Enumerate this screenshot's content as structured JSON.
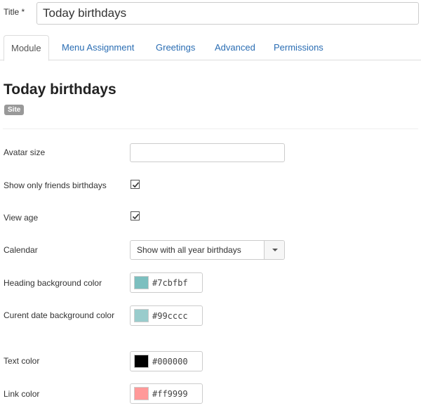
{
  "title_field": {
    "label": "Title *",
    "value": "Today birthdays"
  },
  "tabs": [
    {
      "label": "Module",
      "active": true
    },
    {
      "label": "Menu Assignment",
      "active": false
    },
    {
      "label": "Greetings",
      "active": false
    },
    {
      "label": "Advanced",
      "active": false
    },
    {
      "label": "Permissions",
      "active": false
    }
  ],
  "module": {
    "title": "Today birthdays",
    "badge": "Site"
  },
  "fields": {
    "avatar_size": {
      "label": "Avatar size",
      "value": ""
    },
    "friends_only": {
      "label": "Show only friends birthdays",
      "checked": true
    },
    "view_age": {
      "label": "View age",
      "checked": true
    },
    "calendar": {
      "label": "Calendar",
      "value": "Show with all year birthdays"
    },
    "heading_bg": {
      "label": "Heading background color",
      "value": "#7cbfbf",
      "color": "#7cbfbf"
    },
    "current_date_bg": {
      "label": "Curent date background color",
      "value": "#99cccc",
      "color": "#99cccc"
    },
    "text_color": {
      "label": "Text color",
      "value": "#000000",
      "color": "#000000"
    },
    "link_color": {
      "label": "Link color",
      "value": "#ff9999",
      "color": "#ff9999"
    }
  },
  "colors": {
    "link": "#2a6db3",
    "badge": "#999999"
  }
}
